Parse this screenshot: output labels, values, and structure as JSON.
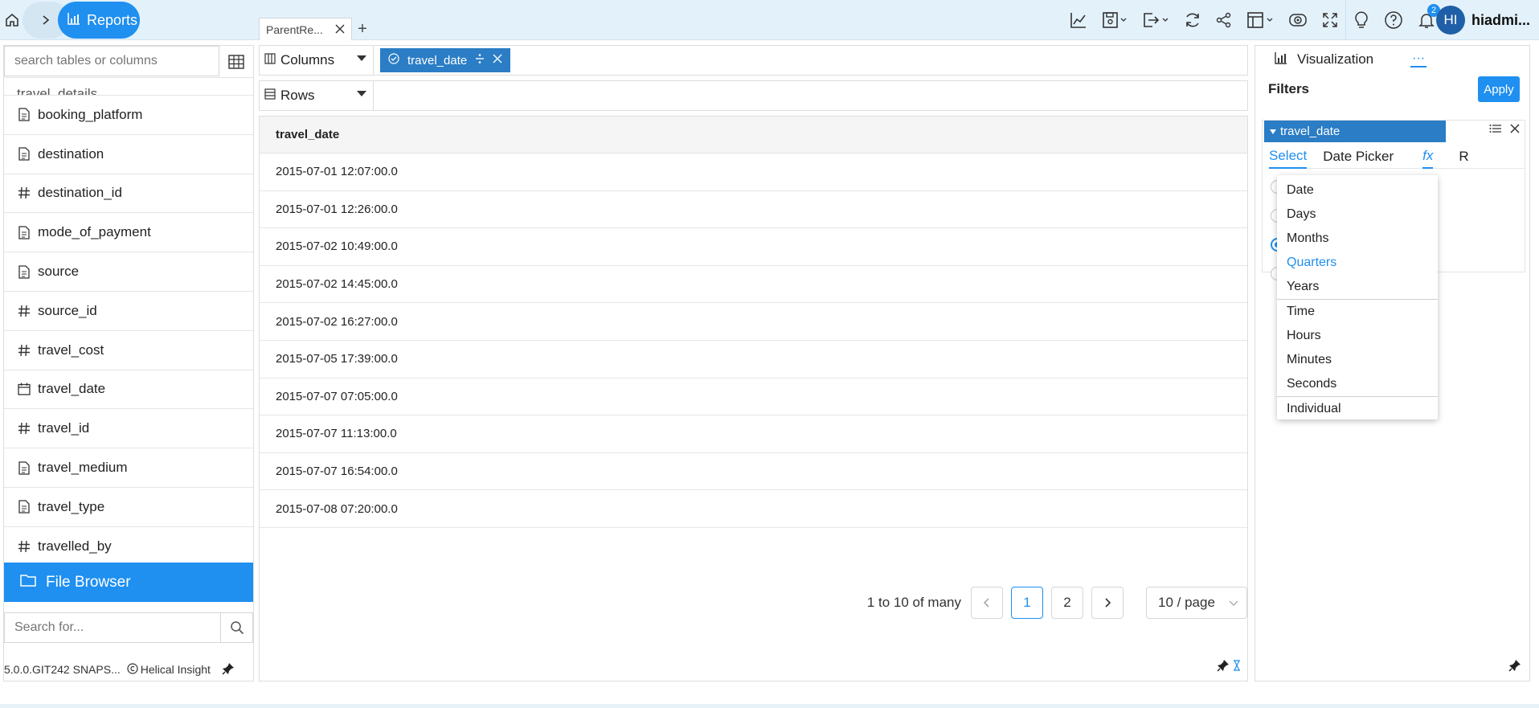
{
  "topbar": {
    "reports_label": "Reports",
    "doc_tab_label": "ParentRe...",
    "add_tab": "+",
    "notifications_count": "2",
    "user_initials": "HI",
    "user_name": "hiadmi..."
  },
  "left_panel": {
    "search_placeholder": "search tables or columns",
    "partial_item": "travel_details",
    "fields": [
      {
        "name": "booking_platform",
        "type": "text"
      },
      {
        "name": "destination",
        "type": "text"
      },
      {
        "name": "destination_id",
        "type": "number"
      },
      {
        "name": "mode_of_payment",
        "type": "text"
      },
      {
        "name": "source",
        "type": "text"
      },
      {
        "name": "source_id",
        "type": "number"
      },
      {
        "name": "travel_cost",
        "type": "number"
      },
      {
        "name": "travel_date",
        "type": "date"
      },
      {
        "name": "travel_id",
        "type": "number"
      },
      {
        "name": "travel_medium",
        "type": "text"
      },
      {
        "name": "travel_type",
        "type": "text"
      },
      {
        "name": "travelled_by",
        "type": "number"
      }
    ],
    "file_browser_label": "File Browser",
    "search_for_placeholder": "Search for...",
    "version": "5.0.0.GIT242 SNAPS...",
    "brand": "Helical Insight"
  },
  "center": {
    "columns_label": "Columns",
    "rows_label": "Rows",
    "column_pill": "travel_date",
    "table_header": "travel_date",
    "rows": [
      "2015-07-01 12:07:00.0",
      "2015-07-01 12:26:00.0",
      "2015-07-02 10:49:00.0",
      "2015-07-02 14:45:00.0",
      "2015-07-02 16:27:00.0",
      "2015-07-05 17:39:00.0",
      "2015-07-07 07:05:00.0",
      "2015-07-07 11:13:00.0",
      "2015-07-07 16:54:00.0",
      "2015-07-08 07:20:00.0"
    ],
    "pager": {
      "info": "1 to 10 of many",
      "page1": "1",
      "page2": "2",
      "per_page": "10 / page"
    }
  },
  "right_panel": {
    "visualization_label": "Visualization",
    "more_label": "···",
    "filters_title": "Filters",
    "apply_label": "Apply",
    "filter_field": "travel_date",
    "subtabs": {
      "select": "Select",
      "date_picker": "Date Picker",
      "fx": "fx",
      "r": "R"
    },
    "dropdown_group1": [
      "Date",
      "Days",
      "Months",
      "Quarters",
      "Years"
    ],
    "dropdown_group2": [
      "Time",
      "Hours",
      "Minutes",
      "Seconds"
    ],
    "dropdown_group3": [
      "Individual"
    ],
    "highlighted_option": "Quarters"
  },
  "colors": {
    "accent": "#1f8ff0",
    "pill": "#2b7dc5",
    "topbar_bg": "#e3f1fb"
  }
}
